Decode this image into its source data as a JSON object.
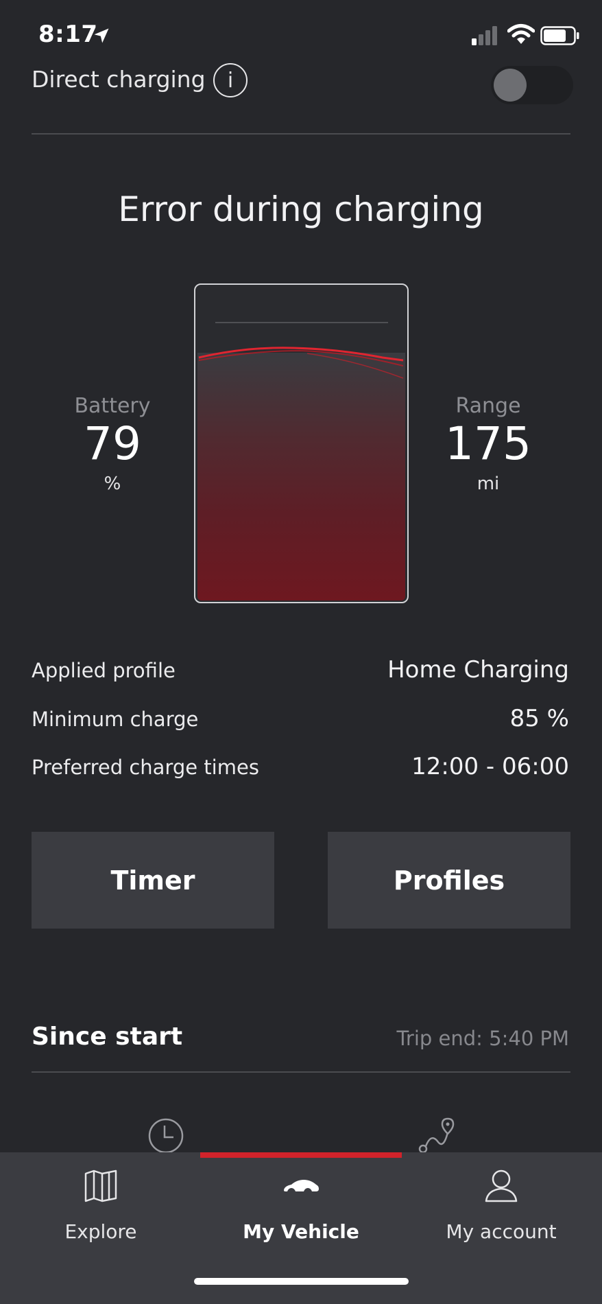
{
  "status_bar": {
    "time": "8:17"
  },
  "direct_charging": {
    "label": "Direct charging",
    "info_glyph": "i",
    "toggle_on": false
  },
  "charging_status": {
    "title": "Error during charging"
  },
  "battery": {
    "label": "Battery",
    "value": "79",
    "unit": "%"
  },
  "range": {
    "label": "Range",
    "value": "175",
    "unit": "mi"
  },
  "details": [
    {
      "label": "Applied profile",
      "value": "Home Charging"
    },
    {
      "label": "Minimum charge",
      "value": "85 %"
    },
    {
      "label": "Preferred charge times",
      "value": "12:00 - 06:00"
    }
  ],
  "buttons": {
    "timer": "Timer",
    "profiles": "Profiles"
  },
  "since_start": {
    "title": "Since start",
    "trip_end": "Trip end: 5:40 PM"
  },
  "tabs": {
    "icons": [
      "clock-icon",
      "route-icon"
    ]
  },
  "nav": {
    "items": [
      {
        "label": "Explore",
        "icon": "map-icon",
        "active": false
      },
      {
        "label": "My Vehicle",
        "icon": "car-icon",
        "active": true
      },
      {
        "label": "My account",
        "icon": "person-icon",
        "active": false
      }
    ]
  },
  "colors": {
    "accent": "#d1232b",
    "background": "#26272b",
    "surface": "#3b3c41"
  }
}
